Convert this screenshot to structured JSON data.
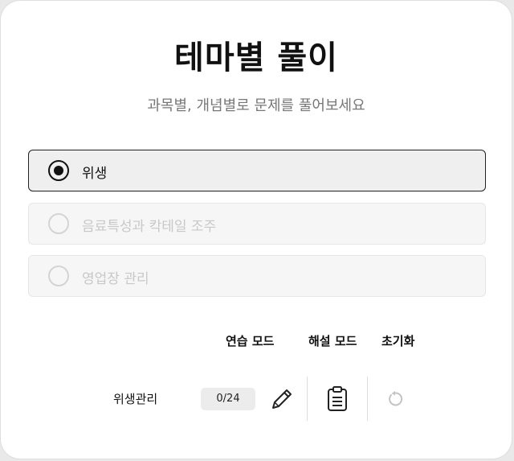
{
  "page": {
    "title": "테마별 풀이",
    "subtitle": "과목별, 개념별로 문제를 풀어보세요"
  },
  "options": [
    {
      "label": "위생",
      "selected": true
    },
    {
      "label": "음료특성과 칵테일 조주",
      "selected": false
    },
    {
      "label": "영업장 관리",
      "selected": false
    }
  ],
  "table": {
    "headers": {
      "practice_mode": "연습 모드",
      "explanation_mode": "해설 모드",
      "reset": "초기화"
    },
    "rows": [
      {
        "label": "위생관리",
        "progress": "0/24",
        "practice_icon": "pencil-icon",
        "explanation_icon": "clipboard-icon",
        "reset_icon": "reset-icon"
      }
    ]
  },
  "colors": {
    "selected_border": "#222222",
    "disabled_text": "#c8c8c8",
    "subtitle_text": "#777777"
  }
}
